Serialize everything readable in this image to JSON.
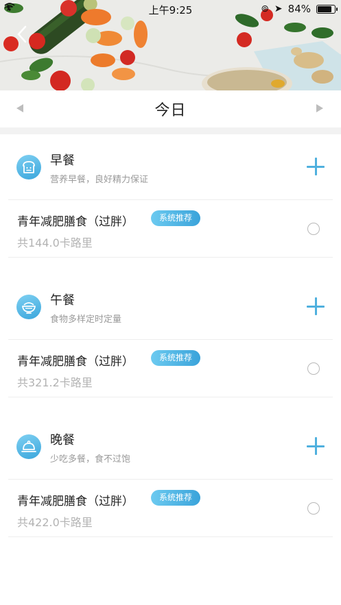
{
  "status_bar": {
    "time": "上午9:25",
    "battery": "84%",
    "battery_level": 0.84
  },
  "header": {
    "back_icon": "chevron-left-icon"
  },
  "date_nav": {
    "title": "今日",
    "prev_icon": "triangle-left-icon",
    "next_icon": "triangle-right-icon"
  },
  "meals": [
    {
      "name": "早餐",
      "desc": "营养早餐，良好精力保证",
      "icon": "bread-icon",
      "plan": {
        "name": "青年减肥膳食（过胖）",
        "badge": "系统推荐",
        "calories": "共144.0卡路里"
      }
    },
    {
      "name": "午餐",
      "desc": "食物多样定时定量",
      "icon": "rice-bowl-icon",
      "plan": {
        "name": "青年减肥膳食（过胖）",
        "badge": "系统推荐",
        "calories": "共321.2卡路里"
      }
    },
    {
      "name": "晚餐",
      "desc": "少吃多餐，食不过饱",
      "icon": "cloche-icon",
      "plan": {
        "name": "青年减肥膳食（过胖）",
        "badge": "系统推荐",
        "calories": "共422.0卡路里"
      }
    }
  ],
  "colors": {
    "accent": "#4fb0de",
    "badge_start": "#6ccaf0",
    "badge_end": "#3aa3da"
  }
}
